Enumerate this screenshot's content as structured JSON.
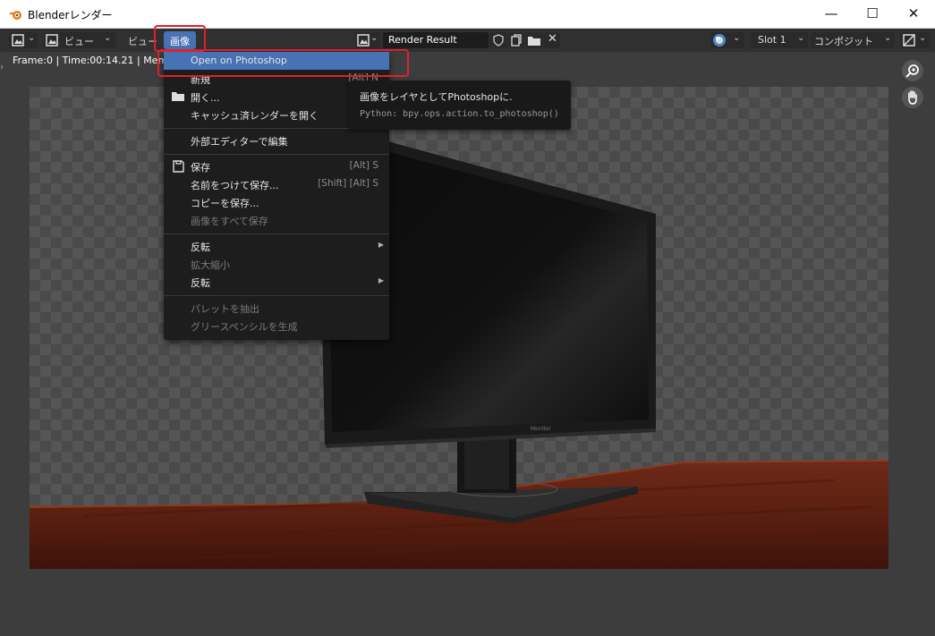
{
  "window": {
    "title": "Blenderレンダー",
    "minimize_icon": "—",
    "maximize_icon": "☐",
    "close_icon": "✕"
  },
  "header": {
    "view_menu": "ビュー",
    "view_menu2": "ビュー",
    "image_menu": "画像",
    "image_name": "Render Result",
    "slot": "Slot 1",
    "layer": "コンポジット"
  },
  "status": {
    "text": "Frame:0 | Time:00:14.21 | Mem:1"
  },
  "image_menu": {
    "items": [
      {
        "label": "Open on Photoshop",
        "shortcut": ""
      },
      {
        "label": "新規",
        "shortcut": "[Alt] N"
      },
      {
        "label": "開く...",
        "shortcut": ""
      },
      {
        "label": "キャッシュ済レンダーを開く",
        "shortcut": "[C"
      },
      {
        "label": "外部エディターで編集",
        "shortcut": ""
      },
      {
        "label": "保存",
        "shortcut": "[Alt] S"
      },
      {
        "label": "名前をつけて保存...",
        "shortcut": "[Shift] [Alt] S"
      },
      {
        "label": "コピーを保存...",
        "shortcut": ""
      },
      {
        "label": "画像をすべて保存",
        "shortcut": ""
      },
      {
        "label": "反転",
        "shortcut": ""
      },
      {
        "label": "拡大縮小",
        "shortcut": ""
      },
      {
        "label": "反転",
        "shortcut": ""
      },
      {
        "label": "パレットを抽出",
        "shortcut": ""
      },
      {
        "label": "グリースペンシルを生成",
        "shortcut": ""
      }
    ]
  },
  "tooltip": {
    "description": "画像をレイヤとしてPhotoshopに.",
    "python": "Python: bpy.ops.action.to_photoshop()"
  },
  "monitor_brand": "Monitor",
  "colors": {
    "highlight": "#4772b3",
    "annotation": "#e0202a",
    "menu_bg": "#1d1d1d"
  }
}
